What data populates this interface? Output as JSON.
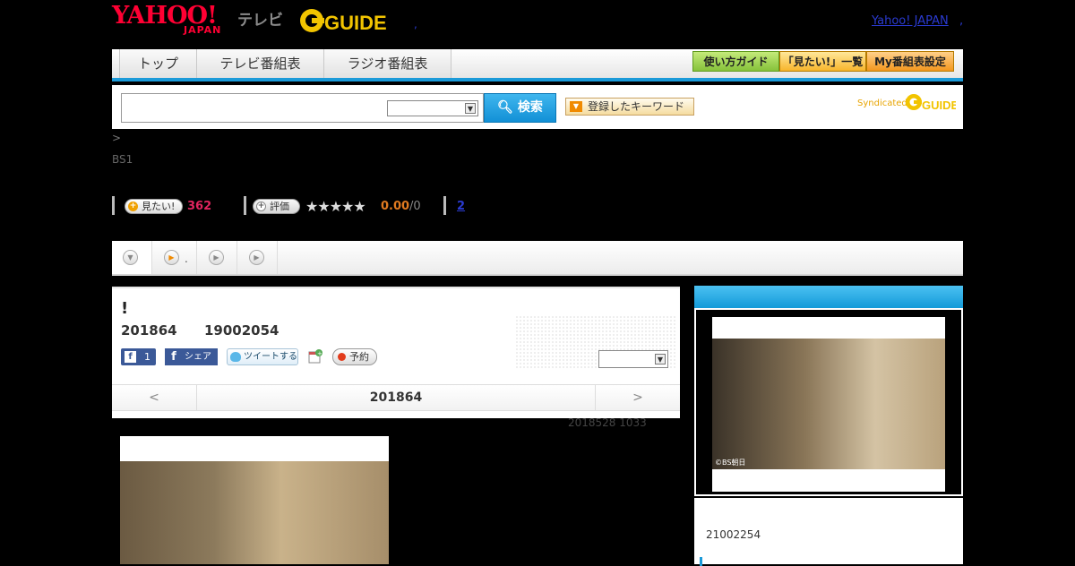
{
  "header": {
    "logo_yahoo": "YAHOO!",
    "logo_japan": "JAPAN",
    "logo_tv": "テレビ",
    "logo_gguide": "G GUIDE",
    "header_dot": ",",
    "top_link": "Yahoo! JAPAN",
    "top_dot": ","
  },
  "nav": {
    "tabs": [
      "トップ",
      "テレビ番組表",
      "ラジオ番組表"
    ],
    "buttons": [
      "使い方ガイド",
      "「見たい!」一覧",
      "My番組表設定"
    ]
  },
  "search": {
    "input_value": "",
    "select_value": "",
    "button_label": "検索",
    "keyword_button": "登録したキーワード",
    "syndicated_label": "Syndicated",
    "syndicated_logo": "G GUIDE"
  },
  "breadcrumb": ">",
  "channel": "BS1",
  "stats": {
    "want_label": "見たい!",
    "want_count": "362",
    "rate_label": "評価",
    "stars": "★★★★★",
    "rating_score": "0.00",
    "rating_count": "/0",
    "link": "2"
  },
  "tabs_row": {
    "tab2_text": "."
  },
  "program": {
    "title": "!",
    "date": "201864",
    "time": "19002054",
    "fb_count": "1",
    "fb_share": "シェア",
    "tweet": "ツイートする",
    "reserve": "予約",
    "select_value": "",
    "nav_prev": "<",
    "nav_date": "201864",
    "nav_next": ">"
  },
  "updated": "2018528  1033",
  "right_column": {
    "photo_credit": "©BS朝日",
    "time": "21002254"
  },
  "colors": {
    "accent_blue": "#1b9ad8",
    "brand_red": "#ff0033",
    "count_pink": "#e0245e",
    "score_orange": "#e07a20",
    "nav_button_green": "#8cc63f",
    "nav_button_orange": "#f7b52c"
  }
}
